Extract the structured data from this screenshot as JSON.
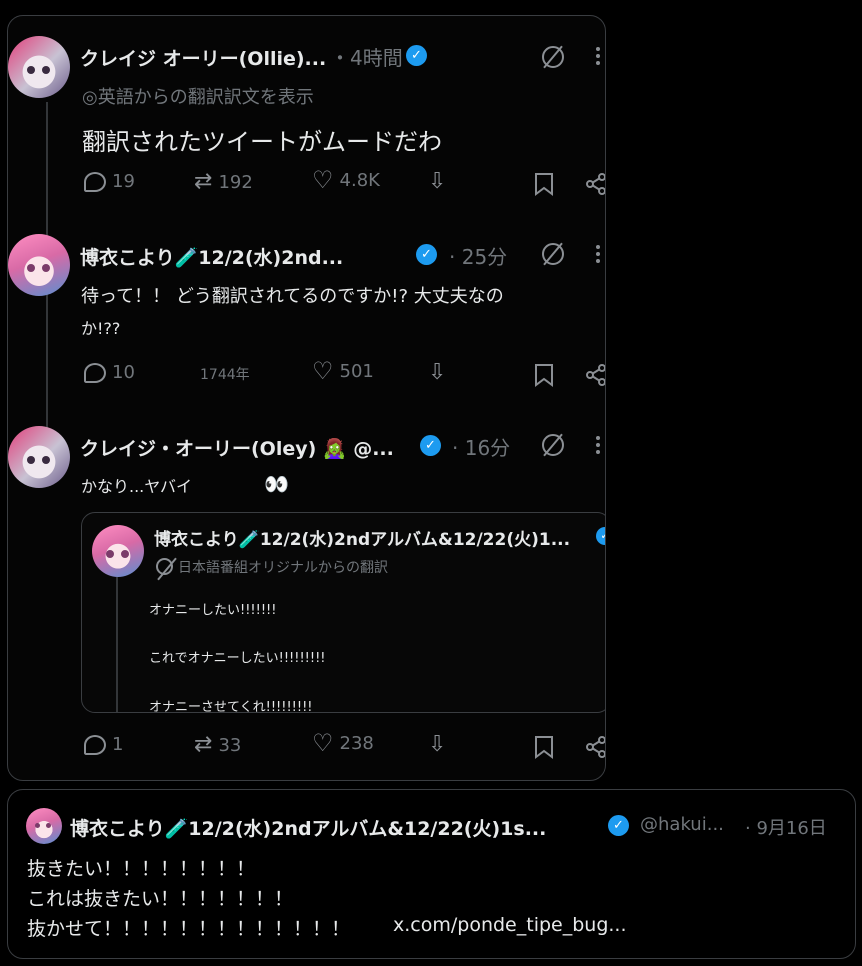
{
  "post1": {
    "name": "クレイジ オーリー(Ollie)...",
    "time": "・4時間",
    "translated_note": "◎英語からの翻訳訳文を表示",
    "text": "翻訳されたツイートがムードだわ",
    "replies": "19",
    "retweets": "192",
    "likes": "4.8K"
  },
  "post2": {
    "name": "博衣こより🧪12/2(水)2nd...",
    "time": "· 25分",
    "text_line1": "待って！！ どう翻訳されてるのですか!? 大丈夫なの",
    "text_line2": "か!??",
    "replies": "10",
    "retweets": "1744年",
    "likes": "501"
  },
  "post3": {
    "name": "クレイジ・オーリー(Oley) 🧟‍♀️ @...",
    "time": "· 16分",
    "text": "かなり...ヤバイ",
    "emoji": "👀",
    "replies": "1",
    "retweets": "33",
    "likes": "238",
    "quote": {
      "name": "博衣こより🧪12/2(水)2ndアルバム&12/22(火)1...",
      "translated_note": "日本語番組オリジナルからの翻訳",
      "line1": "オナニーしたい!!!!!!!",
      "line2": "これでオナニーしたい!!!!!!!!!",
      "line3": "オナニーさせてくれ!!!!!!!!!"
    }
  },
  "post4": {
    "name": "博衣こより🧪12/2(水)2ndアルバム&12/22(火)1s...",
    "handle": "@hakui...",
    "time": "· 9月16日",
    "line1": "抜きたい！！！！！！！！",
    "line2": "これは抜きたい！！！！！！！",
    "line3": "抜かせて！！！！！！！！！！！！！",
    "link": "x.com/ponde_tipe_bug..."
  },
  "icons": {
    "verified": "verified-badge-icon",
    "grok": "grok-icon",
    "more": "more-options-icon",
    "reply": "reply-icon",
    "retweet": "retweet-icon",
    "like": "heart-icon",
    "dislike": "downvote-icon",
    "bookmark": "bookmark-icon",
    "share": "share-icon"
  },
  "colors": {
    "accent": "#1d9bf0",
    "muted": "#71767b",
    "text": "#e7e9ea",
    "border": "#3a3d41"
  }
}
